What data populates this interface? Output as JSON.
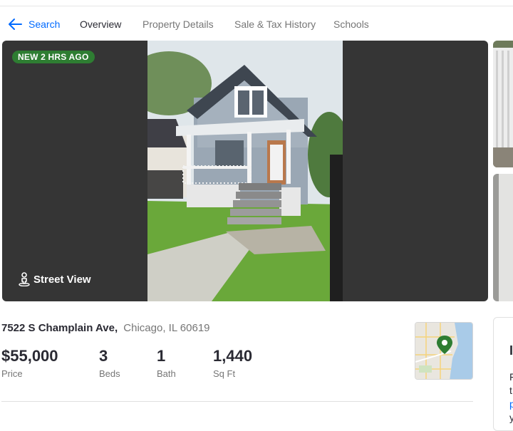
{
  "nav": {
    "back_label": "Search",
    "tabs": [
      {
        "label": "Overview",
        "active": true
      },
      {
        "label": "Property Details",
        "active": false
      },
      {
        "label": "Sale & Tax History",
        "active": false
      },
      {
        "label": "Schools",
        "active": false
      }
    ]
  },
  "gallery": {
    "badge": "NEW 2 HRS AGO",
    "street_view_label": "Street View"
  },
  "listing": {
    "street": "7522 S Champlain Ave,",
    "city": "Chicago, IL 60619",
    "price": "$55,000",
    "price_label": "Price",
    "beds": "3",
    "beds_label": "Beds",
    "baths": "1",
    "baths_label": "Bath",
    "sqft": "1,440",
    "sqft_label": "Sq Ft"
  },
  "side_card": {
    "heading_glyph": "I",
    "line_glyphs": [
      "F",
      "t",
      "p",
      "y"
    ]
  },
  "colors": {
    "accent": "#006aff",
    "badge": "#2e7d32",
    "map_pin": "#2e7d32"
  }
}
